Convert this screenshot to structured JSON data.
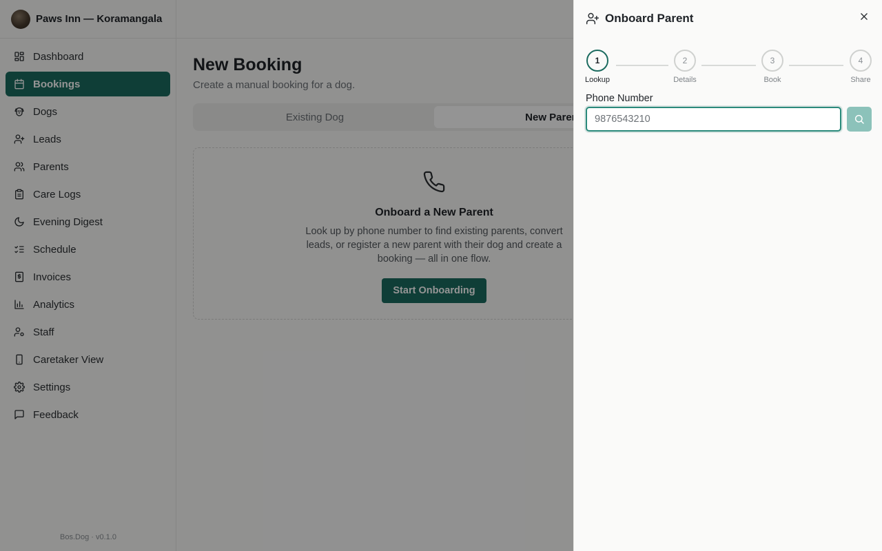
{
  "sidebar": {
    "brand": "Paws Inn — Koramangala",
    "items": [
      {
        "label": "Dashboard",
        "icon": "dashboard-icon"
      },
      {
        "label": "Bookings",
        "icon": "calendar-icon"
      },
      {
        "label": "Dogs",
        "icon": "dog-icon"
      },
      {
        "label": "Leads",
        "icon": "user-plus-icon"
      },
      {
        "label": "Parents",
        "icon": "users-icon"
      },
      {
        "label": "Care Logs",
        "icon": "clipboard-icon"
      },
      {
        "label": "Evening Digest",
        "icon": "moon-icon"
      },
      {
        "label": "Schedule",
        "icon": "list-checks-icon"
      },
      {
        "label": "Invoices",
        "icon": "receipt-icon"
      },
      {
        "label": "Analytics",
        "icon": "bar-chart-icon"
      },
      {
        "label": "Staff",
        "icon": "user-cog-icon"
      },
      {
        "label": "Caretaker View",
        "icon": "smartphone-icon"
      },
      {
        "label": "Settings",
        "icon": "gear-icon"
      },
      {
        "label": "Feedback",
        "icon": "message-square-icon"
      }
    ],
    "active_index": 1,
    "version": "Bos.Dog · v0.1.0"
  },
  "main": {
    "title": "New Booking",
    "subtitle": "Create a manual booking for a dog.",
    "tabs": [
      {
        "label": "Existing Dog"
      },
      {
        "label": "New Parent"
      }
    ],
    "active_tab": 1,
    "card": {
      "icon": "phone-icon",
      "title": "Onboard a New Parent",
      "text": "Look up by phone number to find existing parents, convert leads, or register a new parent with their dog and create a booking — all in one flow.",
      "button": "Start Onboarding"
    }
  },
  "drawer": {
    "title": "Onboard Parent",
    "icon": "user-plus-icon",
    "steps": [
      {
        "num": "1",
        "label": "Lookup"
      },
      {
        "num": "2",
        "label": "Details"
      },
      {
        "num": "3",
        "label": "Book"
      },
      {
        "num": "4",
        "label": "Share"
      }
    ],
    "current_step": 1,
    "field_label": "Phone Number",
    "phone_placeholder": "9876543210"
  },
  "colors": {
    "primary": "#1b6b5f",
    "search_button": "#8cc2ba",
    "focus_ring": "#2a8a7b"
  }
}
